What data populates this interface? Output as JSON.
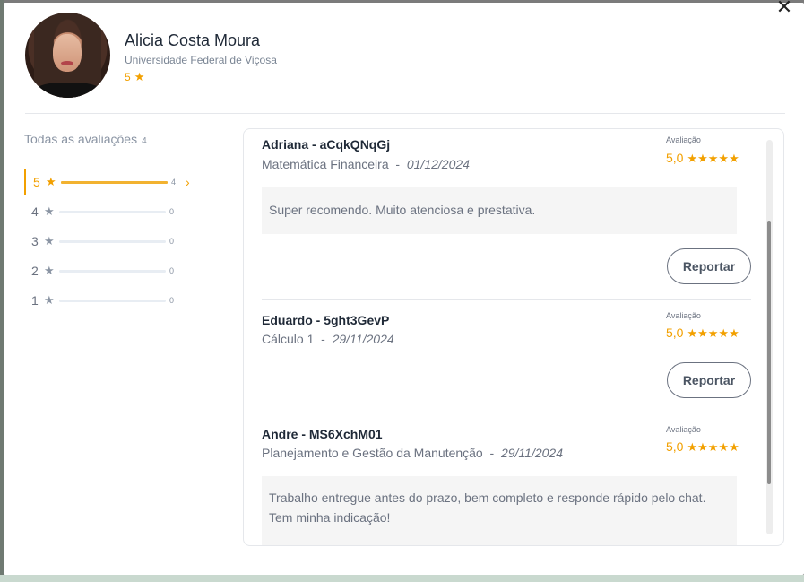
{
  "profile": {
    "name": "Alicia Costa Moura",
    "university": "Universidade Federal de Viçosa",
    "rating": "5",
    "star": "★"
  },
  "summary": {
    "title": "Todas as avaliações",
    "count": "4",
    "rows": [
      {
        "label": "5",
        "count": "4",
        "fraction": 1.0
      },
      {
        "label": "4",
        "count": "0",
        "fraction": 0
      },
      {
        "label": "3",
        "count": "0",
        "fraction": 0
      },
      {
        "label": "2",
        "count": "0",
        "fraction": 0
      },
      {
        "label": "1",
        "count": "0",
        "fraction": 0
      }
    ],
    "chevron": "›"
  },
  "reviews": [
    {
      "author": "Adriana - aCqkQNqGj",
      "course": "Matemática Financeira",
      "date": "01/12/2024",
      "label": "Avaliação",
      "score": "5,0",
      "stars": "★★★★★",
      "text": "Super recomendo. Muito atenciosa e prestativa.",
      "report": "Reportar"
    },
    {
      "author": "Eduardo - 5ght3GevP",
      "course": "Cálculo 1",
      "date": "29/11/2024",
      "label": "Avaliação",
      "score": "5,0",
      "stars": "★★★★★",
      "text": "",
      "report": "Reportar"
    },
    {
      "author": "Andre - MS6XchM01",
      "course": "Planejamento e Gestão da Manutenção",
      "date": "29/11/2024",
      "label": "Avaliação",
      "score": "5,0",
      "stars": "★★★★★",
      "text": "Trabalho entregue antes do prazo, bem completo e responde rápido pelo chat. Tem minha indicação!",
      "report": "Reportar"
    }
  ],
  "ui": {
    "close_glyph": "✕",
    "separator": "-",
    "accent_color": "#f2a000",
    "icons": [
      "close-icon",
      "star-icon",
      "chevron-right-icon"
    ]
  }
}
